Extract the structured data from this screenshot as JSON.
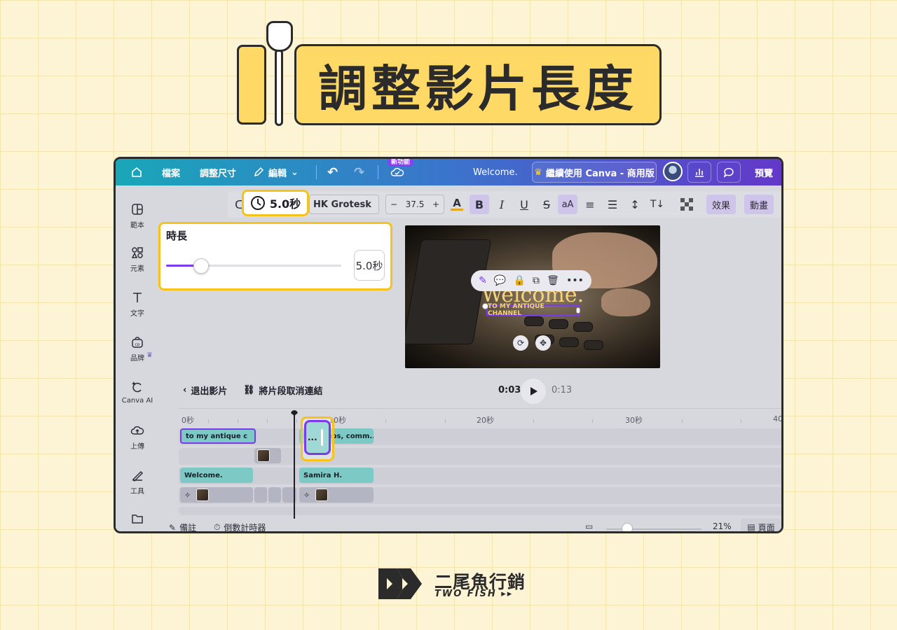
{
  "banner": {
    "title": "調整影片長度"
  },
  "topbar": {
    "file_label": "檔案",
    "resize_label": "調整尺寸",
    "edit_label": "編輯",
    "new_badge": "新功能",
    "doc_title": "Welcome.",
    "upgrade_label": "繼續使用 Canva - 商用版",
    "preview_label": "預覽"
  },
  "sidebar": {
    "items": [
      {
        "label": "範本",
        "icon": "template-icon"
      },
      {
        "label": "元素",
        "icon": "elements-icon"
      },
      {
        "label": "文字",
        "icon": "text-icon"
      },
      {
        "label": "品牌",
        "icon": "brand-icon"
      },
      {
        "label": "Canva AI",
        "icon": "canva-ai-icon"
      },
      {
        "label": "上傳",
        "icon": "upload-icon"
      },
      {
        "label": "工具",
        "icon": "tools-icon"
      }
    ]
  },
  "text_toolbar": {
    "duration": "5.0秒",
    "font": "HK Grotesk",
    "font_size": "37.5",
    "effects_label": "效果",
    "animate_label": "動畫",
    "case_label": "aA"
  },
  "duration_popup": {
    "title": "時長",
    "value": "5.0秒",
    "slider_fraction": 0.2
  },
  "canvas": {
    "headline": "Welcome.",
    "subtitle": "TO MY ANTIQUE CHANNEL"
  },
  "playback": {
    "exit_label": "退出影片",
    "unlink_label": "將片段取消連結",
    "current_time": "0:03",
    "total_time": "0:13"
  },
  "timeline": {
    "ruler": [
      "0秒",
      "10秒",
      "20秒",
      "30秒",
      "40"
    ],
    "clips": {
      "text1": "to my antique c",
      "text2": "like, subs, comm...",
      "title1": "Welcome.",
      "title2": "Samira H."
    }
  },
  "bottombar": {
    "notes_label": "備註",
    "timer_label": "倒數計時器",
    "zoom": "21%",
    "pages_label": "頁面"
  },
  "footer": {
    "brand_name": "二尾魚行銷",
    "brand_sub": "TWO FISH ▸▸"
  },
  "colors": {
    "accent_yellow": "#f7c21c",
    "canva_purple": "#7c3aed",
    "clip_teal": "#7cc9c6"
  }
}
